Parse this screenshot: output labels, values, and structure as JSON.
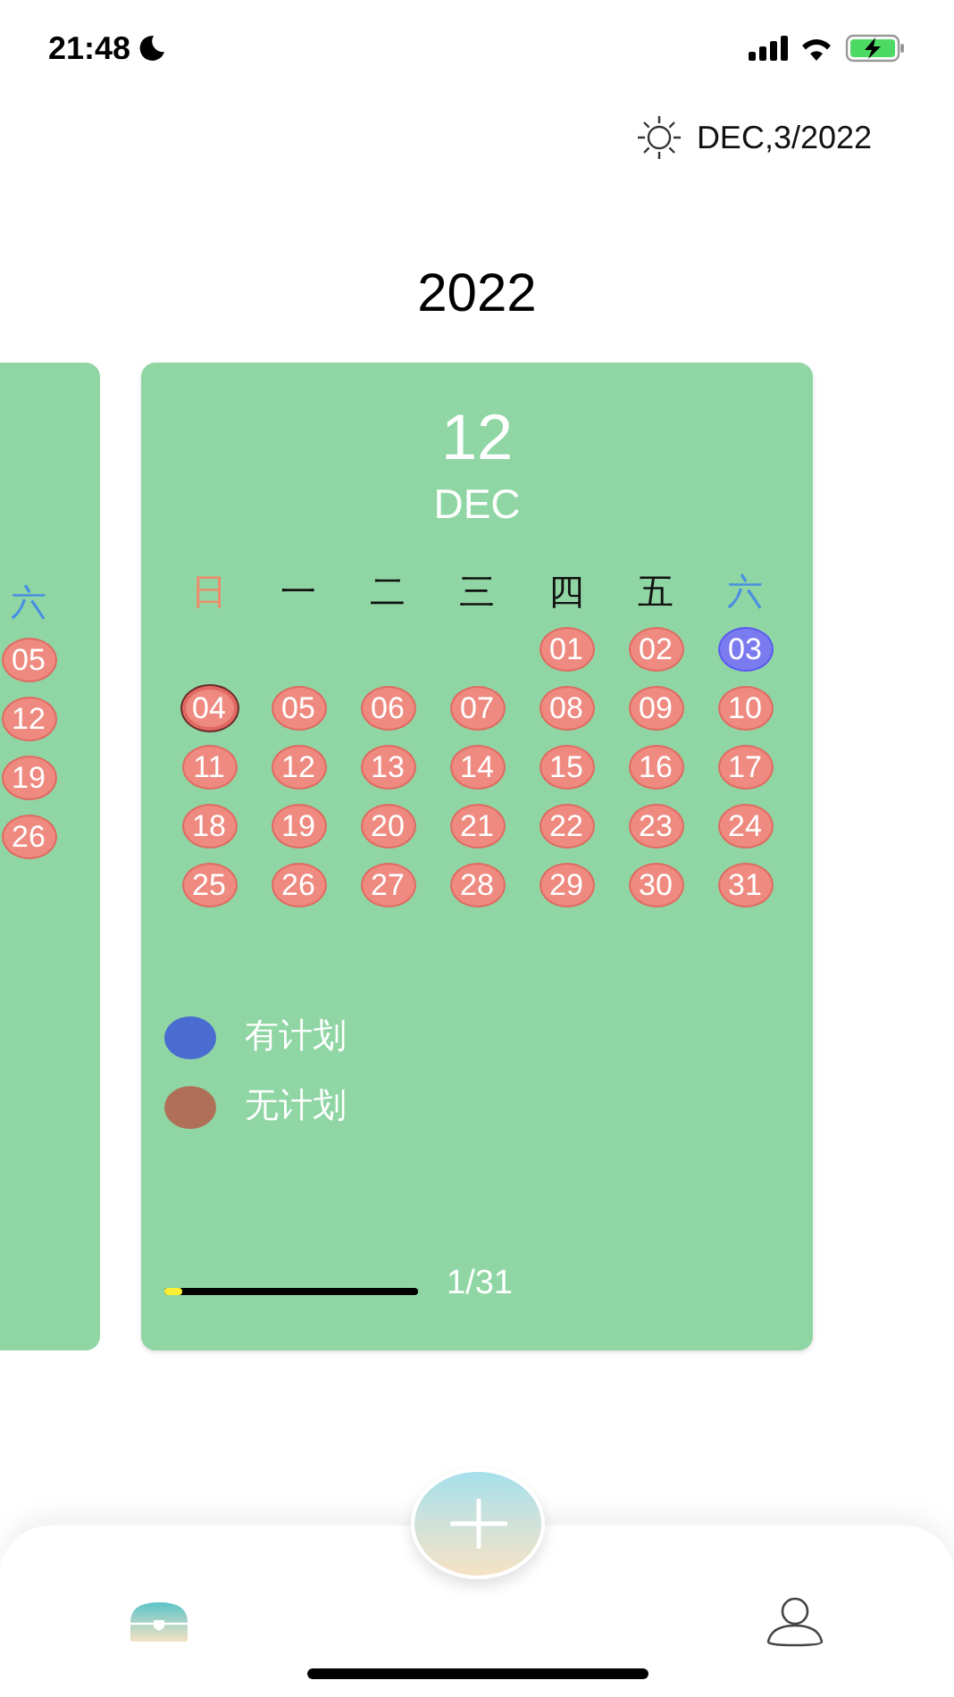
{
  "status_bar": {
    "time": "21:48"
  },
  "header": {
    "date": "DEC,3/2022"
  },
  "year": "2022",
  "prev_card": {
    "weekday": {
      "label": "六",
      "color": "#4a90e2"
    },
    "days": [
      "05",
      "12",
      "19",
      "26"
    ]
  },
  "card": {
    "month_number": "12",
    "month_name": "DEC",
    "weekdays": [
      {
        "label": "日",
        "color": "#f08a6a"
      },
      {
        "label": "一",
        "color": "#111111"
      },
      {
        "label": "二",
        "color": "#111111"
      },
      {
        "label": "三",
        "color": "#111111"
      },
      {
        "label": "四",
        "color": "#111111"
      },
      {
        "label": "五",
        "color": "#111111"
      },
      {
        "label": "六",
        "color": "#4a90e2"
      }
    ],
    "weeks": [
      [
        {
          "kind": "blank"
        },
        {
          "kind": "blank"
        },
        {
          "kind": "blank"
        },
        {
          "kind": "blank"
        },
        {
          "label": "01",
          "today": false,
          "selected": false
        },
        {
          "label": "02",
          "today": false,
          "selected": false
        },
        {
          "label": "03",
          "today": true,
          "selected": false
        }
      ],
      [
        {
          "label": "04",
          "today": false,
          "selected": true
        },
        {
          "label": "05",
          "today": false,
          "selected": false
        },
        {
          "label": "06",
          "today": false,
          "selected": false
        },
        {
          "label": "07",
          "today": false,
          "selected": false
        },
        {
          "label": "08",
          "today": false,
          "selected": false
        },
        {
          "label": "09",
          "today": false,
          "selected": false
        },
        {
          "label": "10",
          "today": false,
          "selected": false
        }
      ],
      [
        {
          "label": "11",
          "today": false,
          "selected": false
        },
        {
          "label": "12",
          "today": false,
          "selected": false
        },
        {
          "label": "13",
          "today": false,
          "selected": false
        },
        {
          "label": "14",
          "today": false,
          "selected": false
        },
        {
          "label": "15",
          "today": false,
          "selected": false
        },
        {
          "label": "16",
          "today": false,
          "selected": false
        },
        {
          "label": "17",
          "today": false,
          "selected": false
        }
      ],
      [
        {
          "label": "18",
          "today": false,
          "selected": false
        },
        {
          "label": "19",
          "today": false,
          "selected": false
        },
        {
          "label": "20",
          "today": false,
          "selected": false
        },
        {
          "label": "21",
          "today": false,
          "selected": false
        },
        {
          "label": "22",
          "today": false,
          "selected": false
        },
        {
          "label": "23",
          "today": false,
          "selected": false
        },
        {
          "label": "24",
          "today": false,
          "selected": false
        }
      ],
      [
        {
          "label": "25",
          "today": false,
          "selected": false
        },
        {
          "label": "26",
          "today": false,
          "selected": false
        },
        {
          "label": "27",
          "today": false,
          "selected": false
        },
        {
          "label": "28",
          "today": false,
          "selected": false
        },
        {
          "label": "29",
          "today": false,
          "selected": false
        },
        {
          "label": "30",
          "today": false,
          "selected": false
        },
        {
          "label": "31",
          "today": false,
          "selected": false
        }
      ]
    ],
    "legend": [
      {
        "label": "有计划",
        "color": "#4a6bd0"
      },
      {
        "label": "无计划",
        "color": "#b07058"
      }
    ],
    "progress": {
      "level": 0.032,
      "reading": "1/31"
    }
  },
  "tabs": [
    {
      "kind": "home",
      "selected": true
    },
    {
      "kind": "profile",
      "selected": false
    }
  ]
}
